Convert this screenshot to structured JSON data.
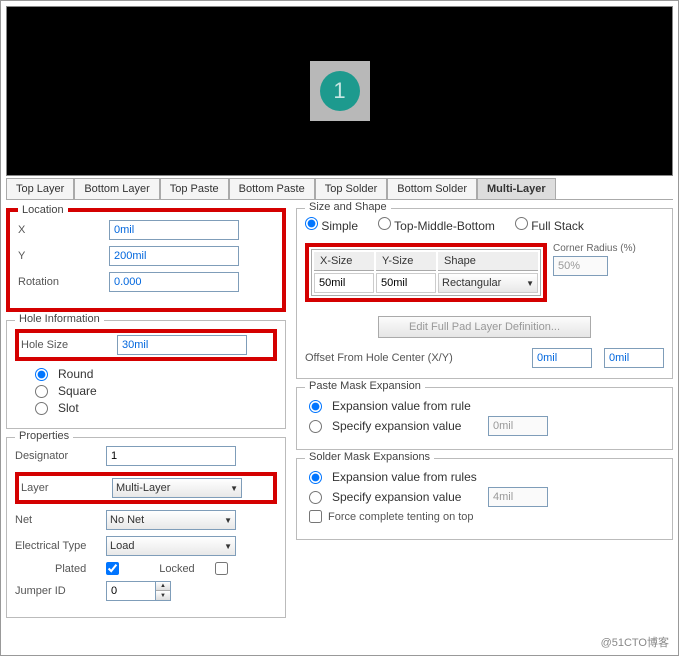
{
  "preview": {
    "designator": "1"
  },
  "tabs": [
    "Top Layer",
    "Bottom Layer",
    "Top Paste",
    "Bottom Paste",
    "Top Solder",
    "Bottom Solder",
    "Multi-Layer"
  ],
  "active_tab": "Multi-Layer",
  "location": {
    "legend": "Location",
    "x_label": "X",
    "x": "0mil",
    "y_label": "Y",
    "y": "200mil",
    "rotation_label": "Rotation",
    "rotation": "0.000"
  },
  "hole": {
    "legend": "Hole Information",
    "size_label": "Hole Size",
    "size": "30mil",
    "round": "Round",
    "square": "Square",
    "slot": "Slot",
    "shape_selected": "Round"
  },
  "properties": {
    "legend": "Properties",
    "designator_label": "Designator",
    "designator": "1",
    "layer_label": "Layer",
    "layer": "Multi-Layer",
    "net_label": "Net",
    "net": "No Net",
    "electrical_label": "Electrical Type",
    "electrical": "Load",
    "plated_label": "Plated",
    "plated": true,
    "locked_label": "Locked",
    "locked": false,
    "jumper_label": "Jumper ID",
    "jumper": "0"
  },
  "size_shape": {
    "legend": "Size and Shape",
    "simple": "Simple",
    "tmb": "Top-Middle-Bottom",
    "full": "Full Stack",
    "mode_selected": "Simple",
    "xsize_h": "X-Size",
    "ysize_h": "Y-Size",
    "shape_h": "Shape",
    "xsize": "50mil",
    "ysize": "50mil",
    "shape": "Rectangular",
    "corner_label": "Corner Radius (%)",
    "corner": "50%",
    "edit_btn": "Edit Full Pad Layer Definition...",
    "offset_label": "Offset From Hole Center (X/Y)",
    "offset_x": "0mil",
    "offset_y": "0mil"
  },
  "paste": {
    "legend": "Paste Mask Expansion",
    "from_rule": "Expansion value from rule",
    "specify": "Specify expansion value",
    "value": "0mil",
    "selected": "from_rule"
  },
  "solder": {
    "legend": "Solder Mask Expansions",
    "from_rule": "Expansion value from rules",
    "specify": "Specify expansion value",
    "value": "4mil",
    "tenting_top": "Force complete tenting on top",
    "selected": "from_rule"
  },
  "watermark": "@51CTO博客"
}
